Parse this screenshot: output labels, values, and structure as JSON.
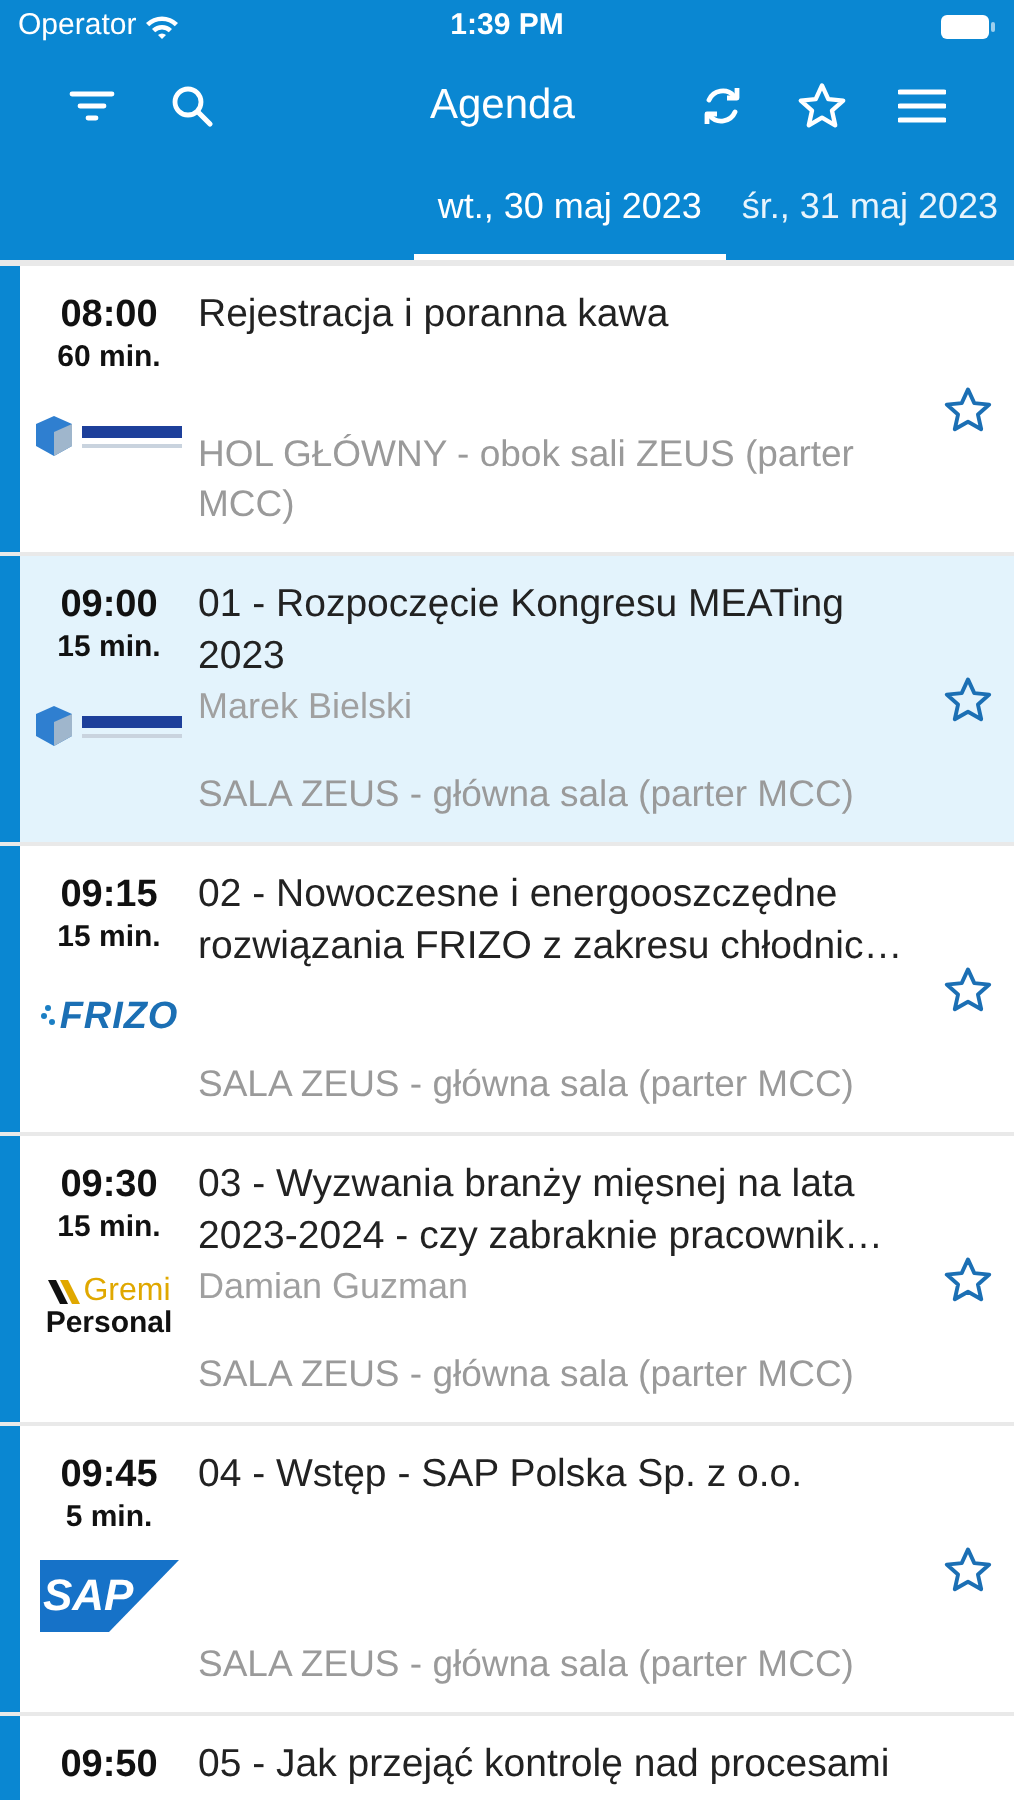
{
  "status_bar": {
    "carrier": "Operator",
    "time": "1:39 PM"
  },
  "toolbar": {
    "title": "Agenda"
  },
  "tabs": [
    {
      "label": "wt., 30 maj 2023",
      "selected": true
    },
    {
      "label": "śr., 31 maj 2023",
      "selected": false
    }
  ],
  "sessions": [
    {
      "time": "08:00",
      "duration": "60 min.",
      "title": "Rejestracja i poranna kawa",
      "location": "HOL GŁÓWNY - obok sali ZEUS (parter MCC)",
      "highlighted": false,
      "favorite": false,
      "logo": {
        "kind": "meat"
      }
    },
    {
      "time": "09:00",
      "duration": "15 min.",
      "title": "01 - Rozpoczęcie Kongresu MEATing 2023",
      "speaker": "Marek Bielski",
      "location": "SALA ZEUS - główna sala (parter MCC)",
      "highlighted": true,
      "favorite": false,
      "logo": {
        "kind": "meat"
      }
    },
    {
      "time": "09:15",
      "duration": "15 min.",
      "title": "02 - Nowoczesne i energooszczędne rozwiązania FRIZO z zakresu chłodnic…",
      "location": "SALA ZEUS - główna sala (parter MCC)",
      "highlighted": false,
      "favorite": false,
      "logo": {
        "kind": "frizo",
        "text": "FRIZO"
      }
    },
    {
      "time": "09:30",
      "duration": "15 min.",
      "title": "03 - Wyzwania branży mięsnej na lata 2023-2024 - czy zabraknie pracownik…",
      "speaker": "Damian Guzman",
      "location": "SALA ZEUS - główna sala (parter MCC)",
      "highlighted": false,
      "favorite": false,
      "logo": {
        "kind": "gremi",
        "text": "Gremi",
        "subtext": "Personal"
      }
    },
    {
      "time": "09:45",
      "duration": "5 min.",
      "title": "04 - Wstęp - SAP Polska Sp. z o.o.",
      "location": "SALA ZEUS - główna sala (parter MCC)",
      "highlighted": false,
      "favorite": false,
      "logo": {
        "kind": "sap",
        "text": "SAP"
      }
    },
    {
      "time": "09:50",
      "title": "05 - Jak przejąć kontrolę nad procesami",
      "highlighted": false
    }
  ]
}
